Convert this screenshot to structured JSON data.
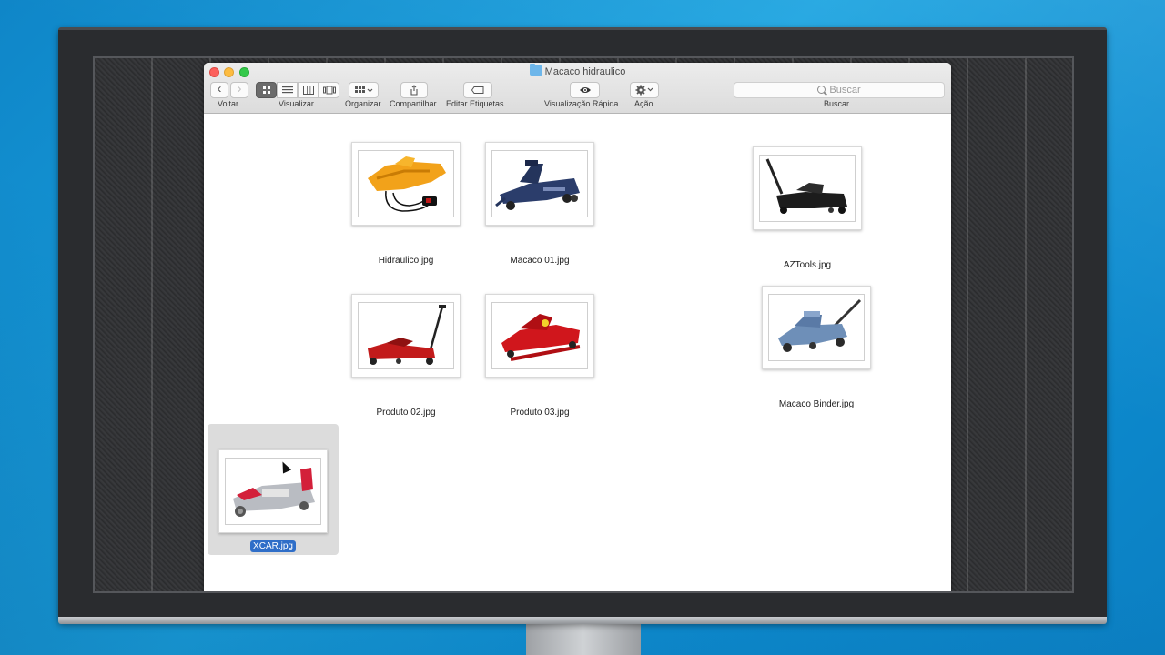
{
  "window": {
    "title": "Macaco hidraulico"
  },
  "toolbar": {
    "back_label": "Voltar",
    "view_label": "Visualizar",
    "arrange_label": "Organizar",
    "share_label": "Compartilhar",
    "tags_label": "Editar Etiquetas",
    "quicklook_label": "Visualização Rápida",
    "action_label": "Ação",
    "search_label": "Buscar",
    "search_placeholder": "Buscar",
    "back_glyph": "‹",
    "forward_glyph": "›"
  },
  "files": [
    {
      "name": "Hidraulico.jpg",
      "selected": false
    },
    {
      "name": "Macaco 01.jpg",
      "selected": false
    },
    {
      "name": "AZTools.jpg",
      "selected": false
    },
    {
      "name": "Produto 02.jpg",
      "selected": false
    },
    {
      "name": "Produto 03.jpg",
      "selected": false
    },
    {
      "name": "Macaco Binder.jpg",
      "selected": false
    },
    {
      "name": "XCAR.jpg",
      "selected": true
    }
  ],
  "colors": {
    "selection": "#2f6ec8",
    "desktop": "#1aa3e0"
  }
}
